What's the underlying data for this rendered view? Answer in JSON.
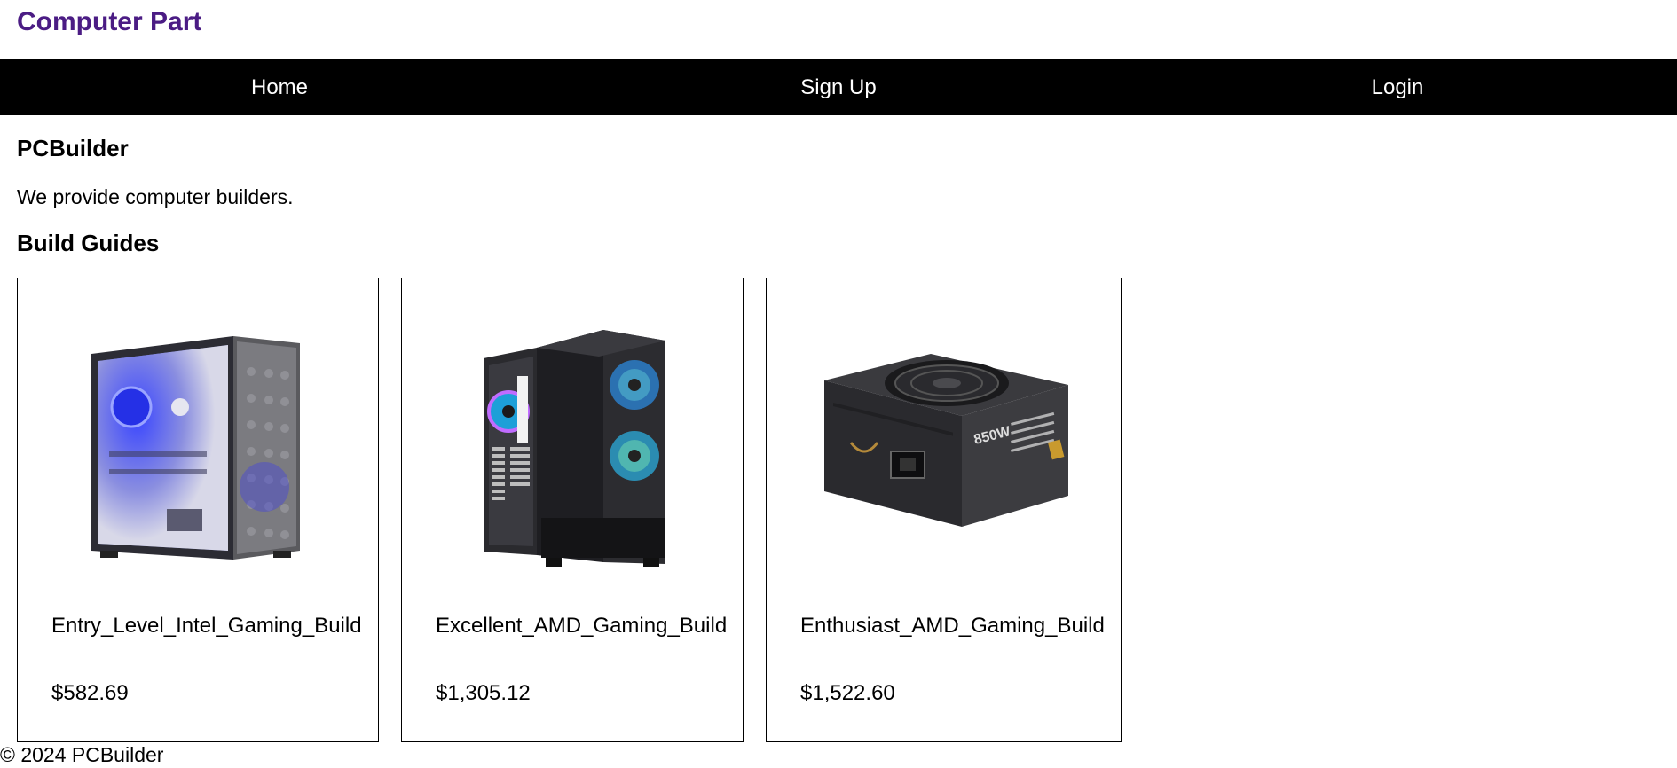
{
  "header": {
    "site_title": "Computer Part"
  },
  "nav": {
    "items": [
      {
        "label": "Home"
      },
      {
        "label": "Sign Up"
      },
      {
        "label": "Login"
      }
    ]
  },
  "main": {
    "brand_heading": "PCBuilder",
    "tagline": "We provide computer builders.",
    "section_heading": "Build Guides",
    "cards": [
      {
        "name": "Entry_Level_Intel_Gaming_Build",
        "price": "$582.69",
        "image": "pc-case-blue-icon"
      },
      {
        "name": "Excellent_AMD_Gaming_Build",
        "price": "$1,305.12",
        "image": "pc-case-rgb-fans-icon"
      },
      {
        "name": "Enthusiast_AMD_Gaming_Build",
        "price": "$1,522.60",
        "image": "power-supply-icon"
      }
    ],
    "psu_label": "850W"
  },
  "footer": {
    "text": "© 2024 PCBuilder"
  },
  "colors": {
    "title": "#4b1c84",
    "navbar": "#000000"
  }
}
